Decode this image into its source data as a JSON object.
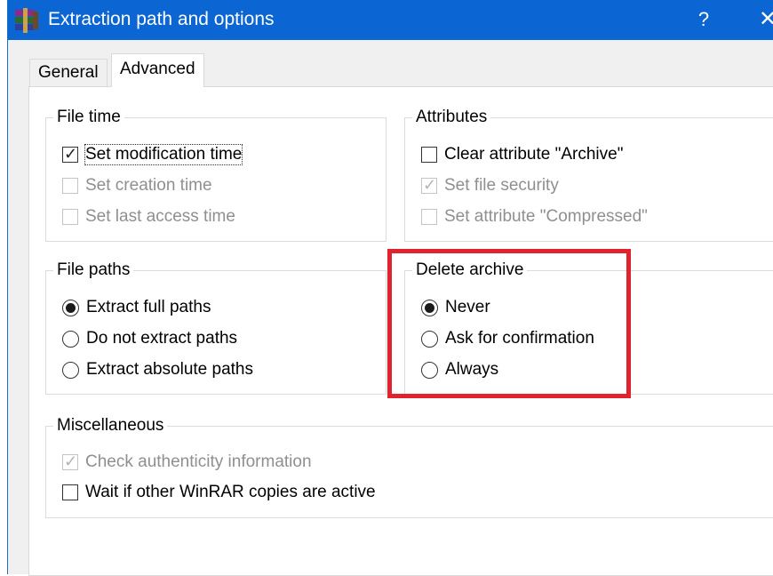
{
  "window": {
    "title": "Extraction path and options",
    "help_label": "?",
    "close_label": "✕"
  },
  "tabs": [
    {
      "label": "General",
      "selected": false
    },
    {
      "label": "Advanced",
      "selected": true
    }
  ],
  "file_time": {
    "title": "File time",
    "items": [
      {
        "label": "Set modification time",
        "checked": true,
        "enabled": true
      },
      {
        "label": "Set creation time",
        "checked": false,
        "enabled": false
      },
      {
        "label": "Set last access time",
        "checked": false,
        "enabled": false
      }
    ]
  },
  "attributes": {
    "title": "Attributes",
    "items": [
      {
        "label": "Clear attribute \"Archive\"",
        "checked": false,
        "enabled": true
      },
      {
        "label": "Set file security",
        "checked": true,
        "enabled": false
      },
      {
        "label": "Set attribute \"Compressed\"",
        "checked": false,
        "enabled": false
      }
    ]
  },
  "file_paths": {
    "title": "File paths",
    "options": [
      {
        "label": "Extract full paths",
        "selected": true
      },
      {
        "label": "Do not extract paths",
        "selected": false
      },
      {
        "label": "Extract absolute paths",
        "selected": false
      }
    ]
  },
  "delete_archive": {
    "title": "Delete archive",
    "options": [
      {
        "label": "Never",
        "selected": true
      },
      {
        "label": "Ask for confirmation",
        "selected": false
      },
      {
        "label": "Always",
        "selected": false
      }
    ]
  },
  "misc": {
    "title": "Miscellaneous",
    "items": [
      {
        "label": "Check authenticity information",
        "checked": true,
        "enabled": false
      },
      {
        "label": "Wait if other WinRAR copies are active",
        "checked": false,
        "enabled": true
      }
    ]
  },
  "colors": {
    "titlebar": "#0b66d4",
    "highlight": "#e0232f"
  }
}
